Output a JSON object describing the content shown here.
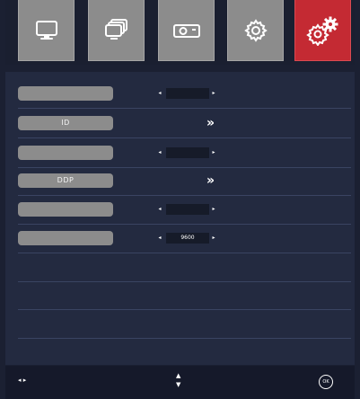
{
  "tabs": [
    {
      "icon": "monitor-icon",
      "active": false
    },
    {
      "icon": "multi-screen-icon",
      "active": false
    },
    {
      "icon": "projector-icon",
      "active": false
    },
    {
      "icon": "gear-icon",
      "active": false
    },
    {
      "icon": "gears-icon",
      "active": true
    }
  ],
  "rows": [
    {
      "label": "",
      "type": "select",
      "value": ""
    },
    {
      "label": "ID",
      "type": "link",
      "value": "»"
    },
    {
      "label": "",
      "type": "select",
      "value": ""
    },
    {
      "label": "DDP",
      "type": "link",
      "value": "»"
    },
    {
      "label": "",
      "type": "select",
      "value": ""
    },
    {
      "label": "",
      "type": "select",
      "value": "9600"
    }
  ],
  "arrows": {
    "left": "◂",
    "right": "▸",
    "up": "▲",
    "down": "▼",
    "leftright": "◂ ▸"
  },
  "footer": {
    "ok": "OK"
  },
  "colors": {
    "active_tab": "#c42a33",
    "tab": "#8c8c8c",
    "panel": "#232a40",
    "background": "#1b2032"
  }
}
